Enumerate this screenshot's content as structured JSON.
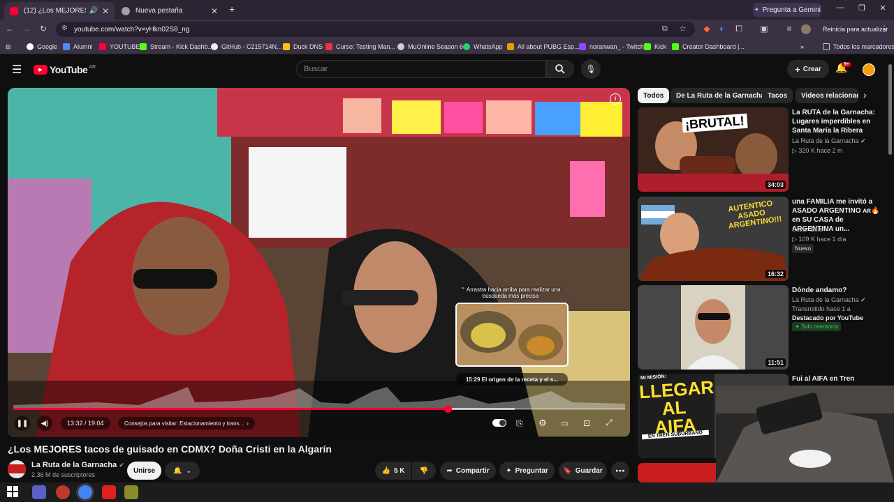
{
  "browser": {
    "tabs": [
      {
        "title": "(12) ¿Los MEJORES tacos d",
        "active": true
      },
      {
        "title": "Nueva pestaña",
        "active": false
      }
    ],
    "gemini_label": "Pregunta a Gemini",
    "url": "youtube.com/watch?v=yHkn02S8_ng",
    "update_label": "Reinicia para actualizar",
    "bookmarks": [
      "Google",
      "Alumni",
      "YOUTUBE",
      "Stream - Kick Dashb...",
      "GitHub - C215714N...",
      "Duck DNS",
      "Curso: Testing Man...",
      "MuOnline Season 6",
      "WhatsApp",
      "All about PUBG Esp...",
      "noranwan_ - Twitch",
      "Kick",
      "Creator Dashboard |..."
    ],
    "all_bookmarks": "Todos los marcadores"
  },
  "youtube": {
    "logo_text": "YouTube",
    "region": "AR",
    "search_placeholder": "Buscar",
    "create_label": "Crear",
    "notif_count": "9+"
  },
  "player": {
    "drag_hint": "⌃ Arrastra hacia arriba para realizar una búsqueda más precisa",
    "preview_chapter": "15:29  El origen de la receta y el s...",
    "time": "13:32 / 19:04",
    "chapter": "Consejos para visitar: Estacionamiento y trans...",
    "progress_fraction": 0.71,
    "hover_fraction": 0.82
  },
  "video": {
    "title": "¿Los MEJORES tacos de guisado en CDMX? Doña Cristi en la Algarín",
    "channel": "La Ruta de la Garnacha",
    "subscribers": "2.36 M de suscriptores",
    "join_label": "Unirse",
    "likes": "5 K",
    "share_label": "Compartir",
    "ask_label": "Preguntar",
    "save_label": "Guardar"
  },
  "chips": [
    "Todos",
    "De La Ruta de la Garnacha",
    "Tacos",
    "Videos relacionados"
  ],
  "related": [
    {
      "title": "La RUTA de la Garnacha: Lugares imperdibles en Santa María la Ribera",
      "channel": "La Ruta de la Garnacha",
      "meta": "▷ 320 K  hace 2 m",
      "duration": "34:03",
      "thumb_text": "¡BRUTAL!",
      "badge": ""
    },
    {
      "title": "una FAMILIA me invitó a ASADO ARGENTINO ᴀʀ🔥 en SU CASA de ARGENTINA un...",
      "channel": "Sezar Blue",
      "meta": "▷ 109 K  hace 1 día",
      "duration": "16:32",
      "thumb_text": "AUTENTICO ASADO ARGENTINO!!!",
      "badge": "Nuevo"
    },
    {
      "title": "Dónde andamo?",
      "channel": "La Ruta de la Garnacha",
      "meta": "Transmitido hace 1 a",
      "duration": "11:51",
      "thumb_text": "",
      "featured": "Destacado por YouTube",
      "members": "Solo miembros"
    },
    {
      "title": "Fui al AIFA en Tren",
      "channel": "",
      "meta": "",
      "duration": "",
      "thumb_text": "LLEGAR AL AIFA",
      "thumb_sub": "EN TREN SUBURBANO",
      "thumb_top": "MI MISIÓN:"
    }
  ],
  "colors": {
    "accent": "#ff0033",
    "bg": "#0f0f0f",
    "chrome": "#3a3144"
  }
}
